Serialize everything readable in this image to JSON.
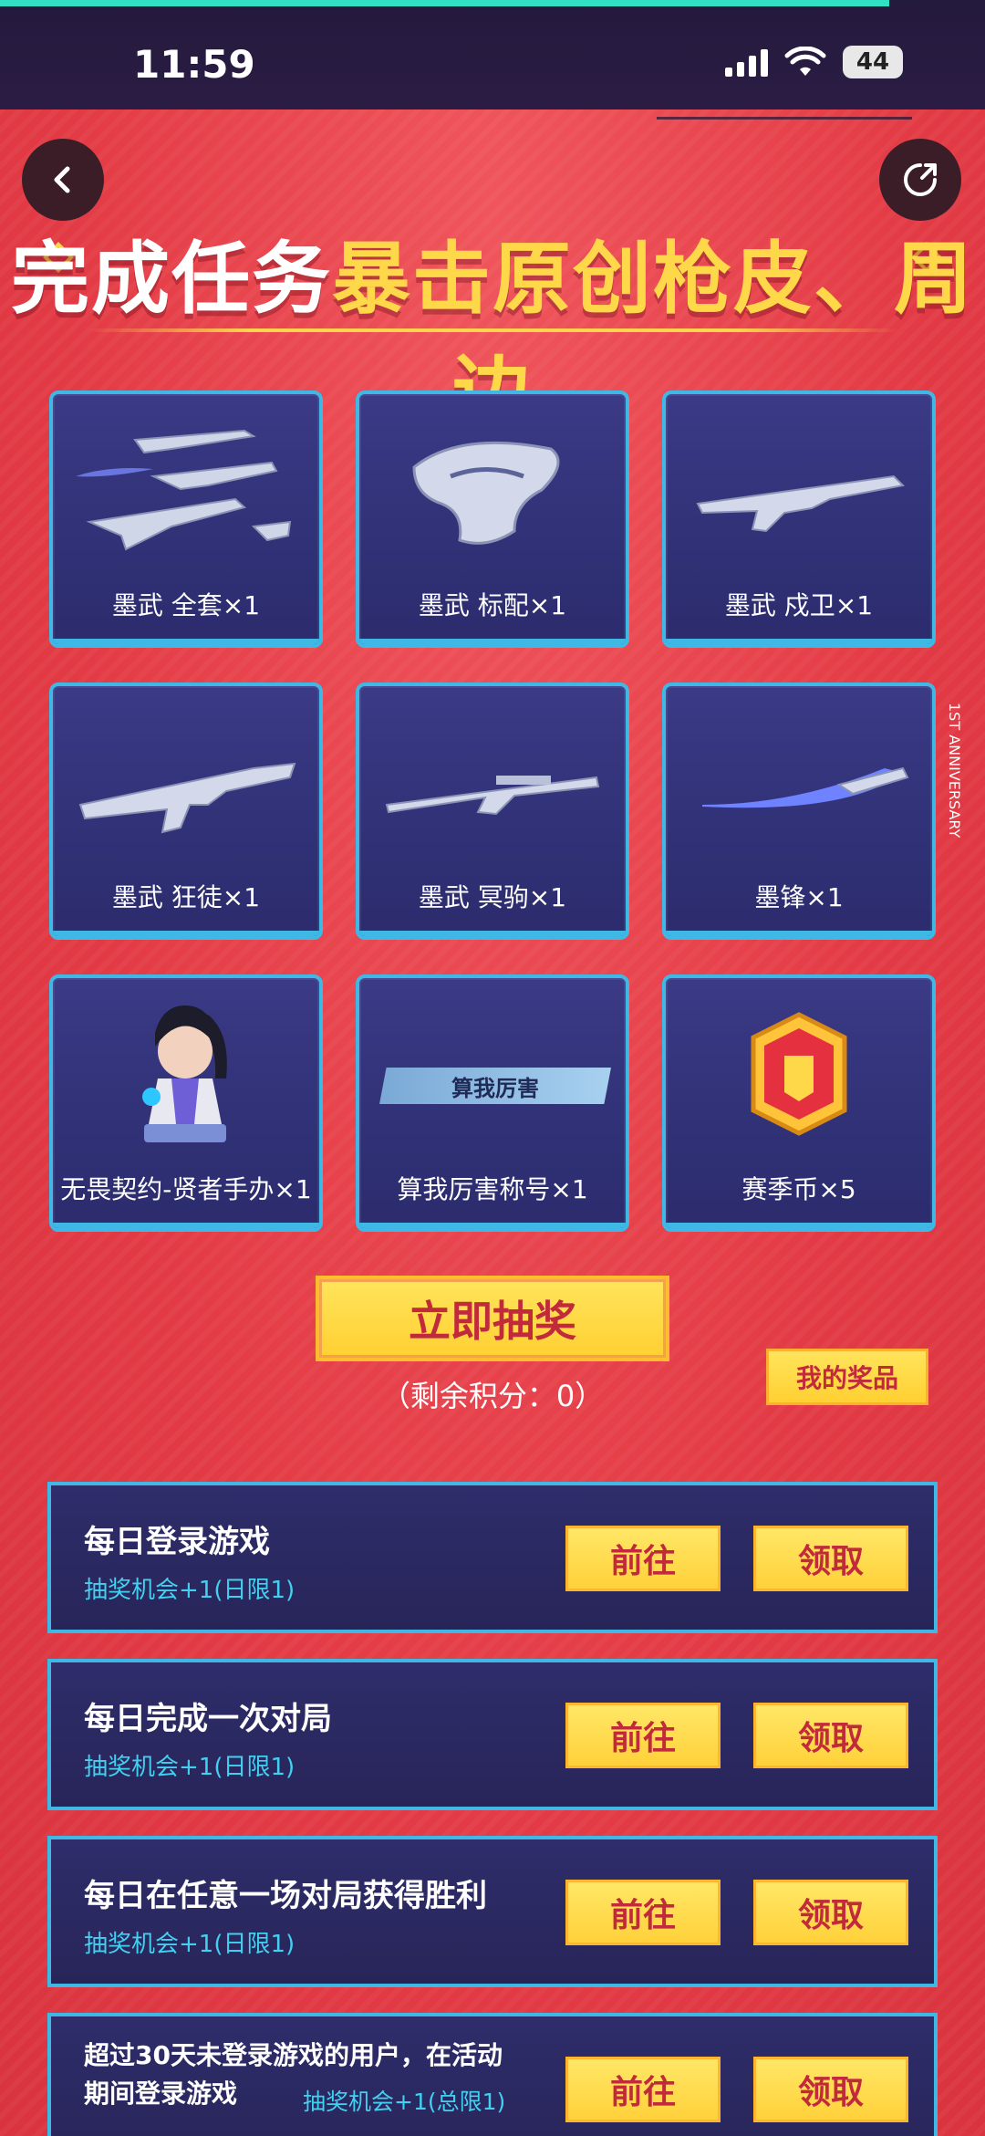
{
  "status_bar": {
    "time": "11:59",
    "battery": "44"
  },
  "header": {
    "title_white": "完成任务",
    "title_yellow": "暴击原创枪皮、周边"
  },
  "prizes": [
    {
      "name": "墨武 全套×1",
      "icon": "weapon-set-icon"
    },
    {
      "name": "墨武 标配×1",
      "icon": "pistol-icon"
    },
    {
      "name": "墨武 戍卫×1",
      "icon": "rifle-icon"
    },
    {
      "name": "墨武 狂徒×1",
      "icon": "rifle-icon"
    },
    {
      "name": "墨武 冥驹×1",
      "icon": "sniper-icon"
    },
    {
      "name": "墨锋×1",
      "icon": "knife-icon"
    },
    {
      "name": "无畏契约-贤者手办×1",
      "icon": "figure-icon"
    },
    {
      "name": "算我厉害称号×1",
      "icon": "title-badge-icon",
      "chip": "算我厉害"
    },
    {
      "name": "赛季币×5",
      "icon": "coin-icon"
    }
  ],
  "draw": {
    "label": "立即抽奖",
    "remaining": "（剩余积分：0）"
  },
  "my_prizes": "我的奖品",
  "tasks": [
    {
      "title": "每日登录游戏",
      "sub": "抽奖机会+1(日限1)",
      "go": "前往",
      "claim": "领取"
    },
    {
      "title": "每日完成一次对局",
      "sub": "抽奖机会+1(日限1)",
      "go": "前往",
      "claim": "领取"
    },
    {
      "title": "每日在任意一场对局获得胜利",
      "sub": "抽奖机会+1(日限1)",
      "go": "前往",
      "claim": "领取"
    },
    {
      "title": "超过30天未登录游戏的用户，在活动期间登录游戏",
      "sub": "抽奖机会+1(总限1)",
      "go": "前往",
      "claim": "领取"
    }
  ],
  "side_text": "1ST ANNIVERSARY",
  "colors": {
    "bg": "#e9424b",
    "card": "#2f2d6b",
    "accent": "#3fb8e6",
    "gold": "#ffd84a"
  }
}
